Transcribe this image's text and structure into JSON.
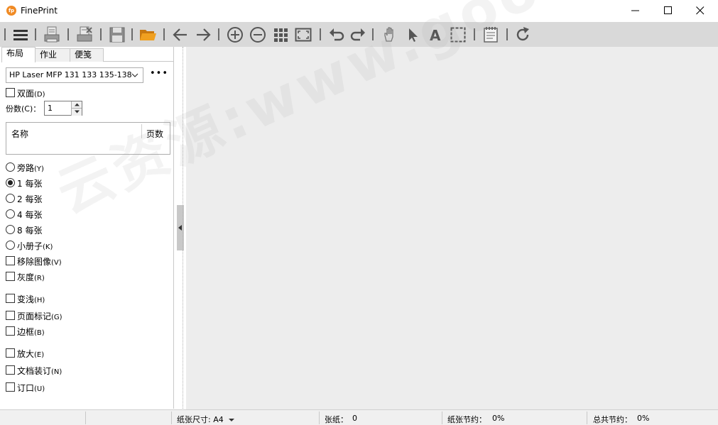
{
  "window": {
    "title": "FinePrint",
    "logo_text": "fp",
    "controls": [
      "minimize",
      "maximize",
      "close"
    ]
  },
  "toolbar": {
    "icons": [
      "menu-icon",
      "print-icon",
      "print-delete-icon",
      "save-icon",
      "open-folder-icon",
      "back-arrow-icon",
      "forward-arrow-icon",
      "zoom-in-icon",
      "zoom-out-icon",
      "grid-view-icon",
      "fit-page-icon",
      "undo-icon",
      "redo-icon",
      "hand-icon",
      "pointer-icon",
      "text-icon",
      "select-region-icon",
      "notepad-icon",
      "refresh-icon"
    ],
    "accent_color": "#f0a020"
  },
  "left_panel": {
    "tabs": [
      {
        "label": "布局",
        "active": true
      },
      {
        "label": "作业",
        "active": false
      },
      {
        "label": "便笺",
        "active": false
      }
    ],
    "printer": "HP Laser MFP 131 133 135-138",
    "more_label": "•••",
    "duplex": {
      "label": "双面",
      "key": "(D)",
      "checked": false
    },
    "copies": {
      "label": "份数(C)：",
      "value": "1"
    },
    "job_table": {
      "col_name": "名称",
      "col_pages": "页数"
    },
    "layout_options": [
      {
        "label": "旁路",
        "key": "(Y)",
        "selected": false
      },
      {
        "label": "1 每张",
        "key": "",
        "selected": true
      },
      {
        "label": "2 每张",
        "key": "",
        "selected": false
      },
      {
        "label": "4 每张",
        "key": "",
        "selected": false
      },
      {
        "label": "8 每张",
        "key": "",
        "selected": false
      },
      {
        "label": "小册子",
        "key": "(K)",
        "selected": false
      }
    ],
    "checkboxes": [
      {
        "label": "移除图像",
        "key": "(V)",
        "checked": false
      },
      {
        "label": "灰度",
        "key": "(R)",
        "checked": false
      },
      {
        "label": "变浅",
        "key": "(H)",
        "checked": false
      },
      {
        "label": "页面标记",
        "key": "(G)",
        "checked": false
      },
      {
        "label": "边框",
        "key": "(B)",
        "checked": false
      },
      {
        "label": "放大",
        "key": "(E)",
        "checked": false
      },
      {
        "label": "文档装订",
        "key": "(N)",
        "checked": false
      },
      {
        "label": "订口",
        "key": "(U)",
        "checked": false
      }
    ]
  },
  "watermark": "云资源:www.goodziyuan.com",
  "status_bar": {
    "paper_size_label": "纸张尺寸: A4",
    "sheets_label": "张纸：",
    "sheets_value": "0",
    "paper_saved_label": "纸张节约：",
    "paper_saved_value": "0%",
    "total_saved_label": "总共节约：",
    "total_saved_value": "0%"
  }
}
